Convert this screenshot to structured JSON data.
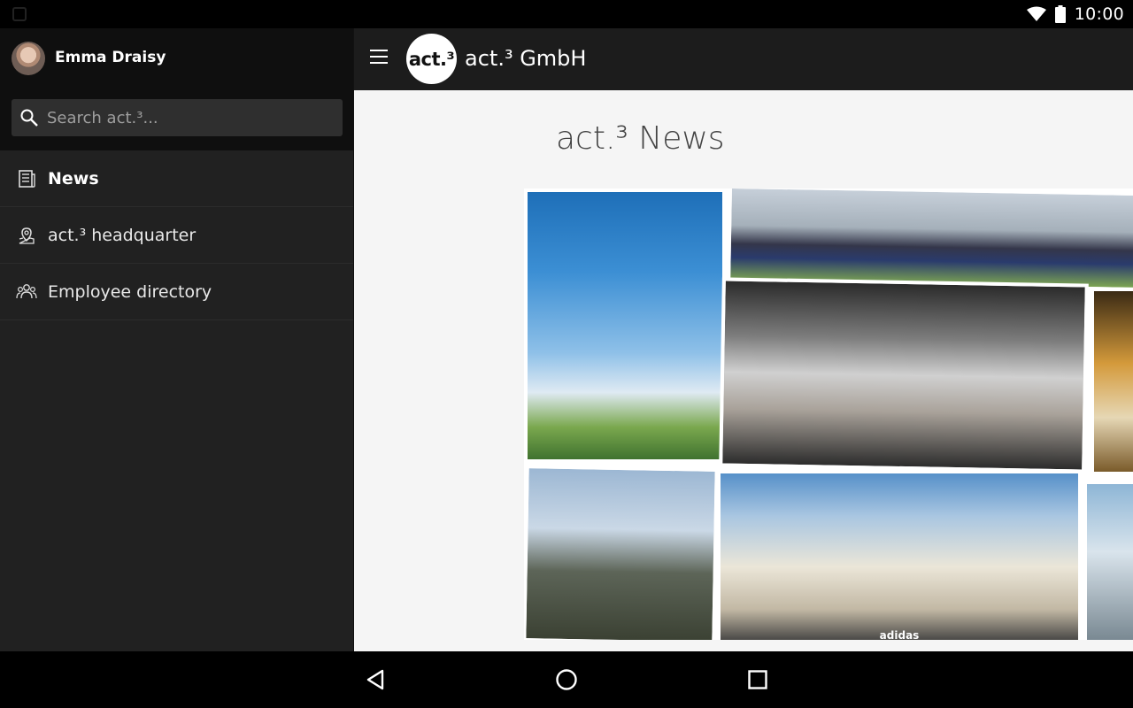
{
  "status_bar": {
    "time": "10:00"
  },
  "drawer": {
    "user_name": "Emma Draisy",
    "search": {
      "placeholder": "Search act.³..."
    },
    "items": [
      {
        "label": "News",
        "icon": "news-icon",
        "active": true
      },
      {
        "label": "act.³ headquarter",
        "icon": "location-pin-icon",
        "active": false
      },
      {
        "label": "Employee directory",
        "icon": "people-icon",
        "active": false
      }
    ]
  },
  "appbar": {
    "logo_text": "act.³",
    "title": "act.³ GmbH"
  },
  "main": {
    "title": "act.³ News",
    "collage_caption": "adidas"
  },
  "colors": {
    "drawer_bg": "#212121",
    "appbar_bg": "#1c1c1c",
    "content_bg": "#f5f5f5"
  }
}
